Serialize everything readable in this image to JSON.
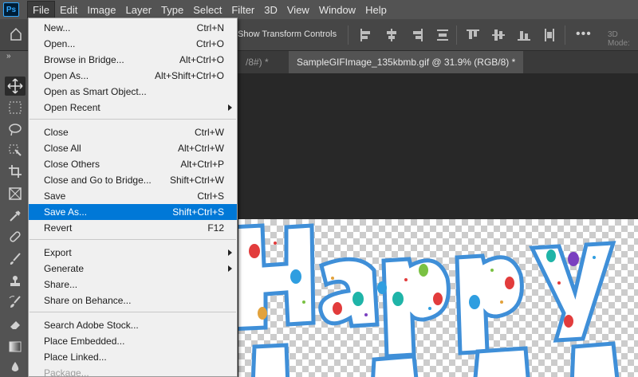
{
  "app": {
    "logo_text": "Ps"
  },
  "menubar": {
    "items": [
      "File",
      "Edit",
      "Image",
      "Layer",
      "Type",
      "Select",
      "Filter",
      "3D",
      "View",
      "Window",
      "Help"
    ],
    "active": "File"
  },
  "options": {
    "transform_label": "Show Transform Controls",
    "more_label": "•••",
    "mode_3d": "3D Mode:"
  },
  "tabs": [
    {
      "label": "/8#) *",
      "active": false
    },
    {
      "label": "SampleGIFImage_135kbmb.gif @ 31.9% (RGB/8) *",
      "active": true
    }
  ],
  "file_menu": {
    "groups": [
      [
        {
          "label": "New...",
          "shortcut": "Ctrl+N"
        },
        {
          "label": "Open...",
          "shortcut": "Ctrl+O"
        },
        {
          "label": "Browse in Bridge...",
          "shortcut": "Alt+Ctrl+O"
        },
        {
          "label": "Open As...",
          "shortcut": "Alt+Shift+Ctrl+O"
        },
        {
          "label": "Open as Smart Object...",
          "shortcut": ""
        },
        {
          "label": "Open Recent",
          "shortcut": "",
          "submenu": true
        }
      ],
      [
        {
          "label": "Close",
          "shortcut": "Ctrl+W"
        },
        {
          "label": "Close All",
          "shortcut": "Alt+Ctrl+W"
        },
        {
          "label": "Close Others",
          "shortcut": "Alt+Ctrl+P"
        },
        {
          "label": "Close and Go to Bridge...",
          "shortcut": "Shift+Ctrl+W"
        },
        {
          "label": "Save",
          "shortcut": "Ctrl+S"
        },
        {
          "label": "Save As...",
          "shortcut": "Shift+Ctrl+S",
          "highlighted": true
        },
        {
          "label": "Revert",
          "shortcut": "F12"
        }
      ],
      [
        {
          "label": "Export",
          "shortcut": "",
          "submenu": true
        },
        {
          "label": "Generate",
          "shortcut": "",
          "submenu": true
        },
        {
          "label": "Share...",
          "shortcut": ""
        },
        {
          "label": "Share on Behance...",
          "shortcut": ""
        }
      ],
      [
        {
          "label": "Search Adobe Stock...",
          "shortcut": ""
        },
        {
          "label": "Place Embedded...",
          "shortcut": ""
        },
        {
          "label": "Place Linked...",
          "shortcut": ""
        },
        {
          "label": "Package...",
          "shortcut": "",
          "disabled": true
        }
      ]
    ]
  },
  "canvas": {
    "checker_light": "#ffffff",
    "checker_dark": "#cccccc",
    "outline_color": "#3f8fd8"
  },
  "colors": {
    "menubar": "#535353",
    "highlight": "#0078d7",
    "menu_bg": "#f0f0f0"
  }
}
